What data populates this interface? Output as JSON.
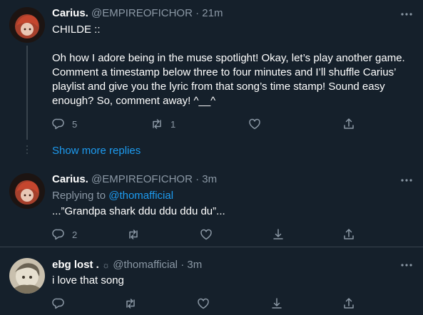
{
  "tweets": [
    {
      "name": "Carius.",
      "handle": "@EMPIREOFICHOR",
      "separator": "·",
      "time": "21m",
      "text": "CHILDE ::\n\nOh how I adore being in the muse spotlight! Okay, let’s play another game. Comment a timestamp below three to four minutes and I’ll shuffle Carius’ playlist and give you the lyric from that song’s time stamp! Sound easy enough? So, comment away! ^__^",
      "reply_count": "5",
      "retweet_count": "1"
    },
    {
      "name": "Carius.",
      "handle": "@EMPIREOFICHOR",
      "separator": "·",
      "time": "3m",
      "replying_label": "Replying to",
      "replying_to": "@thomafficial",
      "text": "...”Grandpa shark ddu ddu ddu du”...",
      "reply_count": "2"
    },
    {
      "name": "ebg lost .",
      "badge": "☼",
      "handle": "@thomafficial",
      "separator": "·",
      "time": "3m",
      "text": "i love that song"
    }
  ],
  "show_more_replies": "Show more replies",
  "colors": {
    "background": "#15202b",
    "accent": "#1d9bf0",
    "secondary_text": "#8b98a5",
    "divider": "#38444d"
  },
  "icons": [
    "reply-icon",
    "retweet-icon",
    "like-icon",
    "download-icon",
    "share-icon",
    "more-icon"
  ]
}
